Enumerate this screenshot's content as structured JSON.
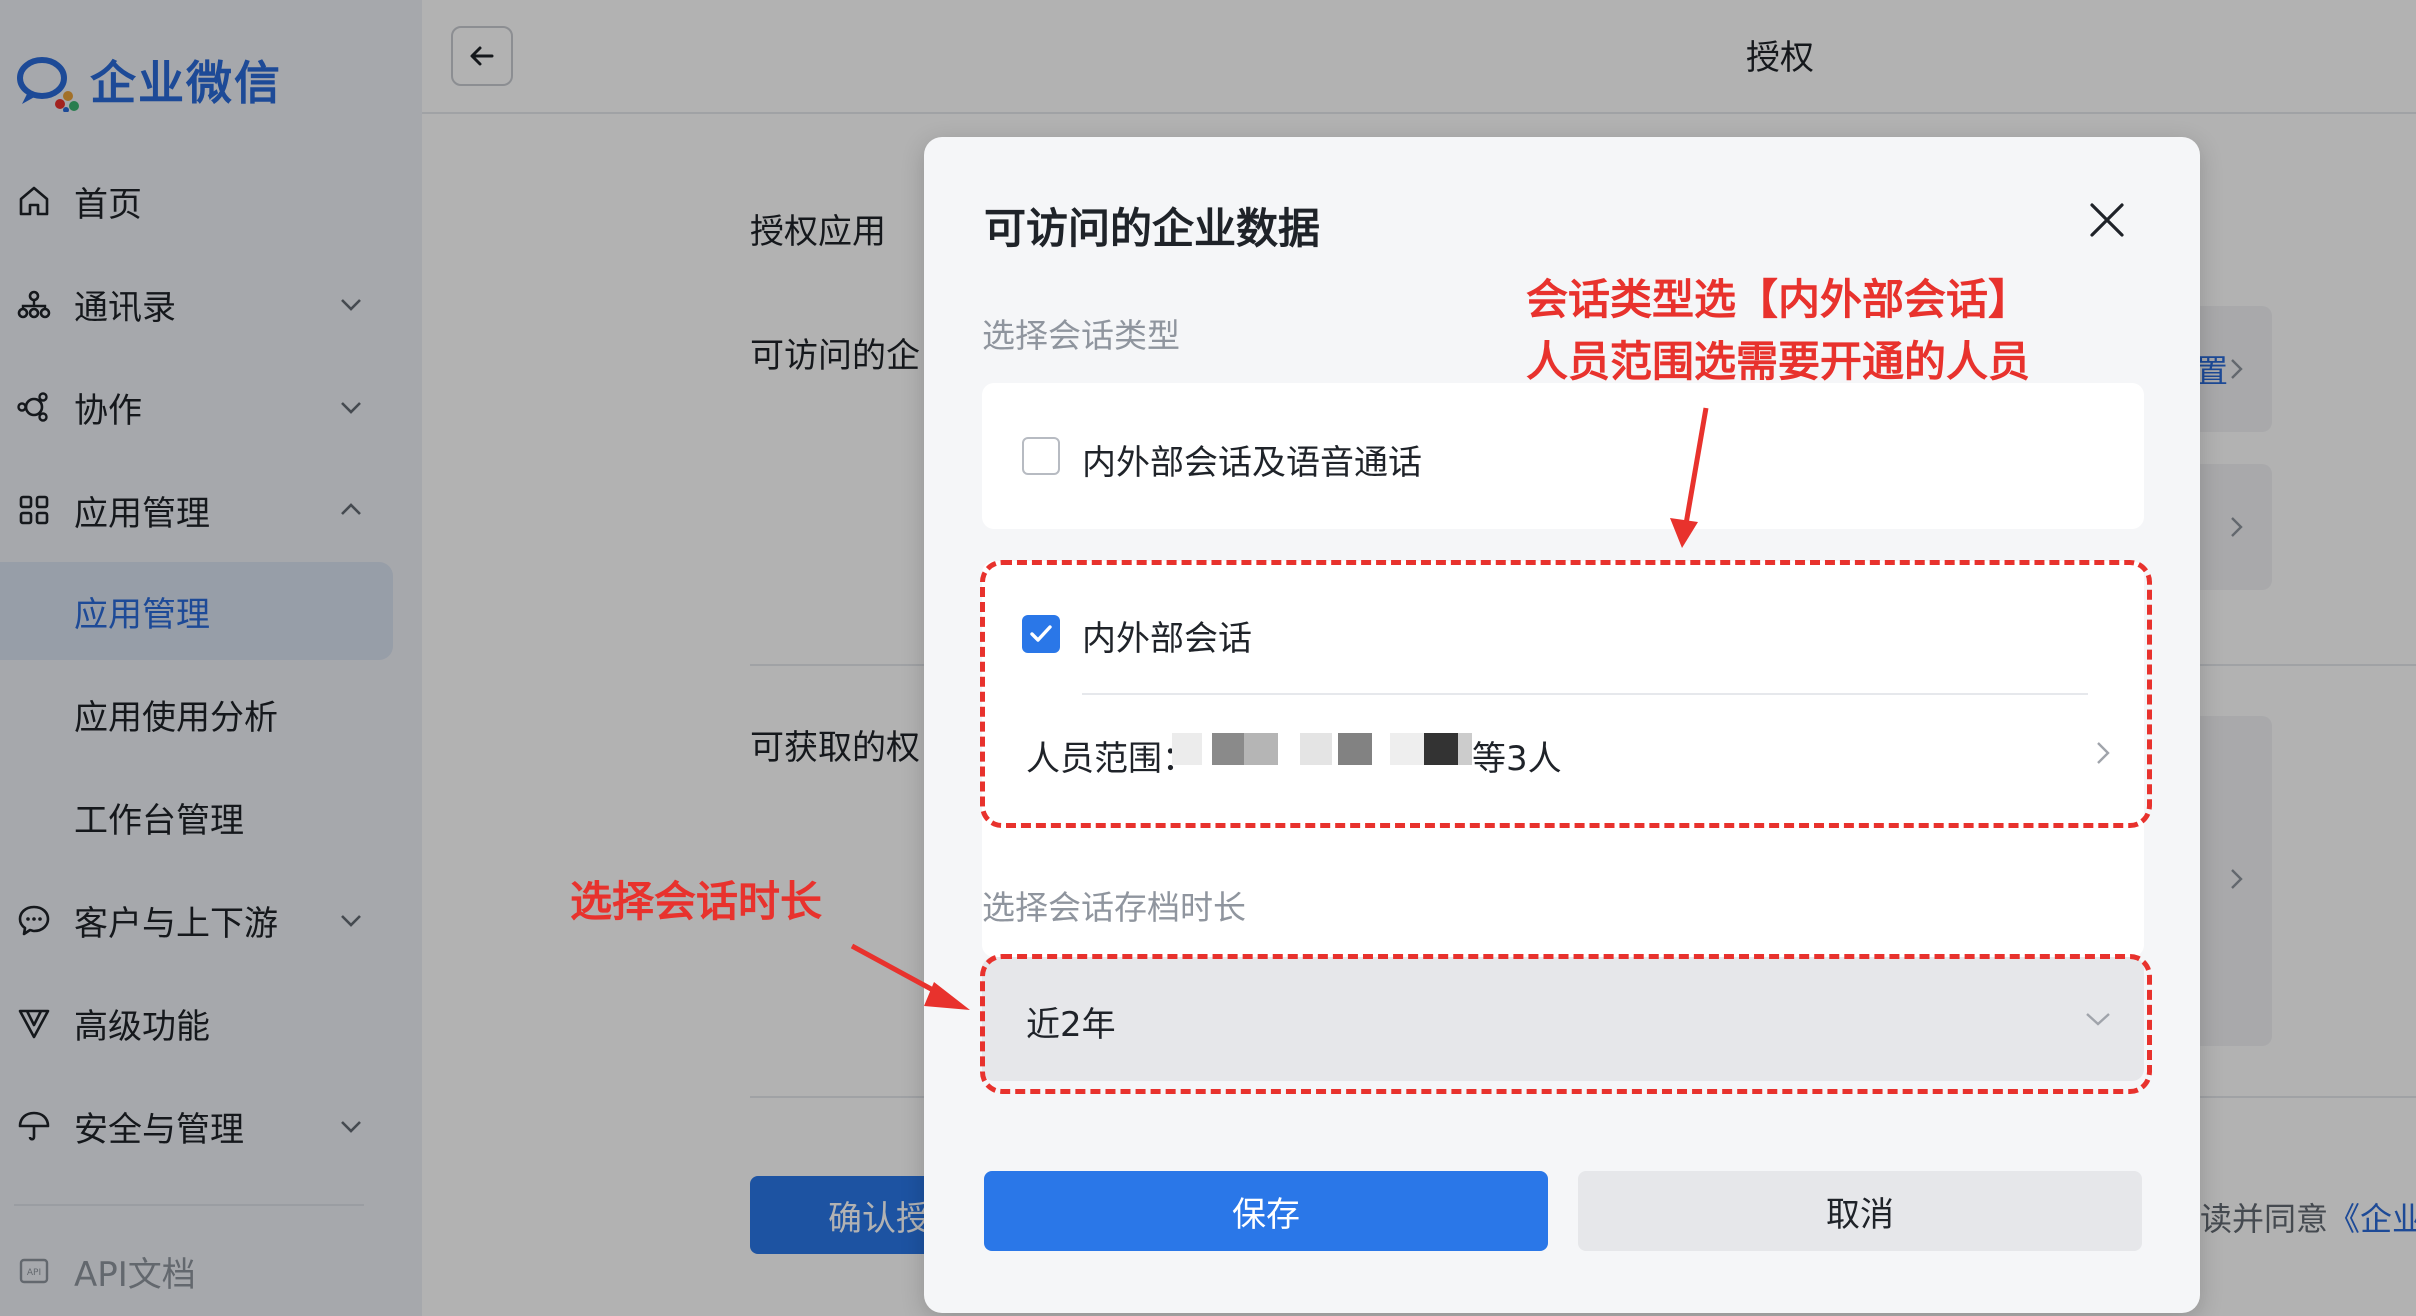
{
  "app": {
    "logo_text": "企业微信"
  },
  "sidebar": {
    "items": [
      {
        "label": "首页"
      },
      {
        "label": "通讯录"
      },
      {
        "label": "协作"
      },
      {
        "label": "应用管理"
      },
      {
        "label": "应用管理"
      },
      {
        "label": "应用使用分析"
      },
      {
        "label": "工作台管理"
      },
      {
        "label": "客户与上下游"
      },
      {
        "label": "高级功能"
      },
      {
        "label": "安全与管理"
      }
    ],
    "api_label": "API文档"
  },
  "header": {
    "title": "授权"
  },
  "background": {
    "label_app": "授权应用",
    "label_data": "可访问的企",
    "label_perm": "可获取的权",
    "confirm_button": "确认授",
    "agree_prefix": "读并同意",
    "agree_link": "《企业",
    "side_link": "置"
  },
  "modal": {
    "title": "可访问的企业数据",
    "section_type": "选择会话类型",
    "option_voice": {
      "label": "内外部会话及语音通话",
      "checked": false
    },
    "option_session": {
      "label": "内外部会话",
      "checked": true
    },
    "scope_label": "人员范围：",
    "scope_suffix": "等3人",
    "section_duration": "选择会话存档时长",
    "duration_value": "近2年",
    "save_button": "保存",
    "cancel_button": "取消"
  },
  "annotations": {
    "note_top_line1": "会话类型选【内外部会话】",
    "note_top_line2": "人员范围选需要开通的人员",
    "note_left": "选择会话时长",
    "color": "#e8322d"
  },
  "colors": {
    "accent": "#2a77e8",
    "brand": "#2a6ad8",
    "annotation": "#e8322d"
  }
}
